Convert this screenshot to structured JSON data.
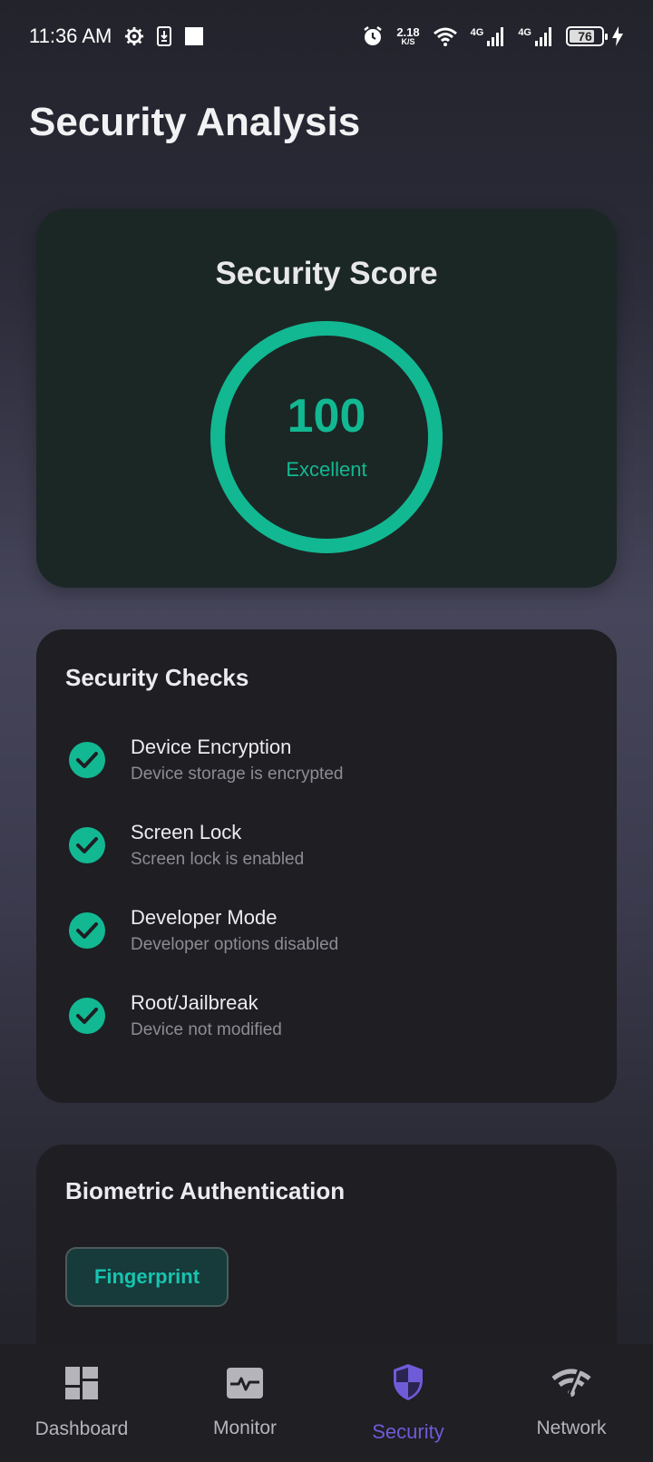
{
  "status_bar": {
    "time": "11:36 AM",
    "net_speed": "2.18",
    "net_unit": "K/S",
    "net_type_1": "4G",
    "net_type_2": "4G",
    "battery": "76"
  },
  "page_title": "Security Analysis",
  "score_card": {
    "title": "Security Score",
    "value": "100",
    "grade": "Excellent",
    "color": "#12b892"
  },
  "checks": {
    "heading": "Security Checks",
    "items": [
      {
        "title": "Device Encryption",
        "description": "Device storage is encrypted",
        "status": "passed"
      },
      {
        "title": "Screen Lock",
        "description": "Screen lock is enabled",
        "status": "passed"
      },
      {
        "title": "Developer Mode",
        "description": "Developer options disabled",
        "status": "passed"
      },
      {
        "title": "Root/Jailbreak",
        "description": "Device not modified",
        "status": "passed"
      }
    ]
  },
  "biometric": {
    "heading": "Biometric Authentication",
    "button_label": "Fingerprint"
  },
  "nav": {
    "items": [
      {
        "label": "Dashboard",
        "icon": "dashboard-icon"
      },
      {
        "label": "Monitor",
        "icon": "monitor-icon"
      },
      {
        "label": "Security",
        "icon": "shield-icon",
        "active": true
      },
      {
        "label": "Network",
        "icon": "wifi-off-icon"
      }
    ],
    "active_color": "#6f5bd8"
  }
}
